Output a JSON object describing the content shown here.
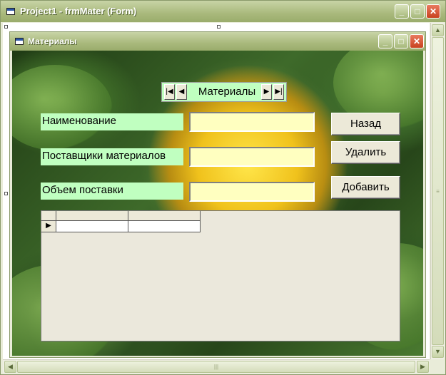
{
  "outer_window": {
    "title": "Project1 - frmMater (Form)"
  },
  "inner_window": {
    "title": "Материалы"
  },
  "navigator": {
    "caption": "Материалы",
    "first_glyph": "|◀",
    "prev_glyph": "◀",
    "next_glyph": "▶",
    "last_glyph": "▶|"
  },
  "fields": [
    {
      "label": "Наименование",
      "value": ""
    },
    {
      "label": "Поставщики материалов",
      "value": ""
    },
    {
      "label": "Объем поставки",
      "value": ""
    }
  ],
  "buttons": {
    "back": "Назад",
    "delete": "Удалить",
    "add": "Добавить"
  },
  "grid": {
    "row_marker": "▶"
  },
  "window_controls": {
    "minimize": "_",
    "maximize": "□",
    "close": "✕"
  },
  "scroll_glyphs": {
    "up": "▲",
    "down": "▼",
    "left": "◀",
    "right": "▶",
    "grip": "≡",
    "hgrip": "|||"
  },
  "colors": {
    "label_bg": "#c0ffc0",
    "input_bg": "#ffffc0",
    "titlebar": "#a9b97c"
  }
}
